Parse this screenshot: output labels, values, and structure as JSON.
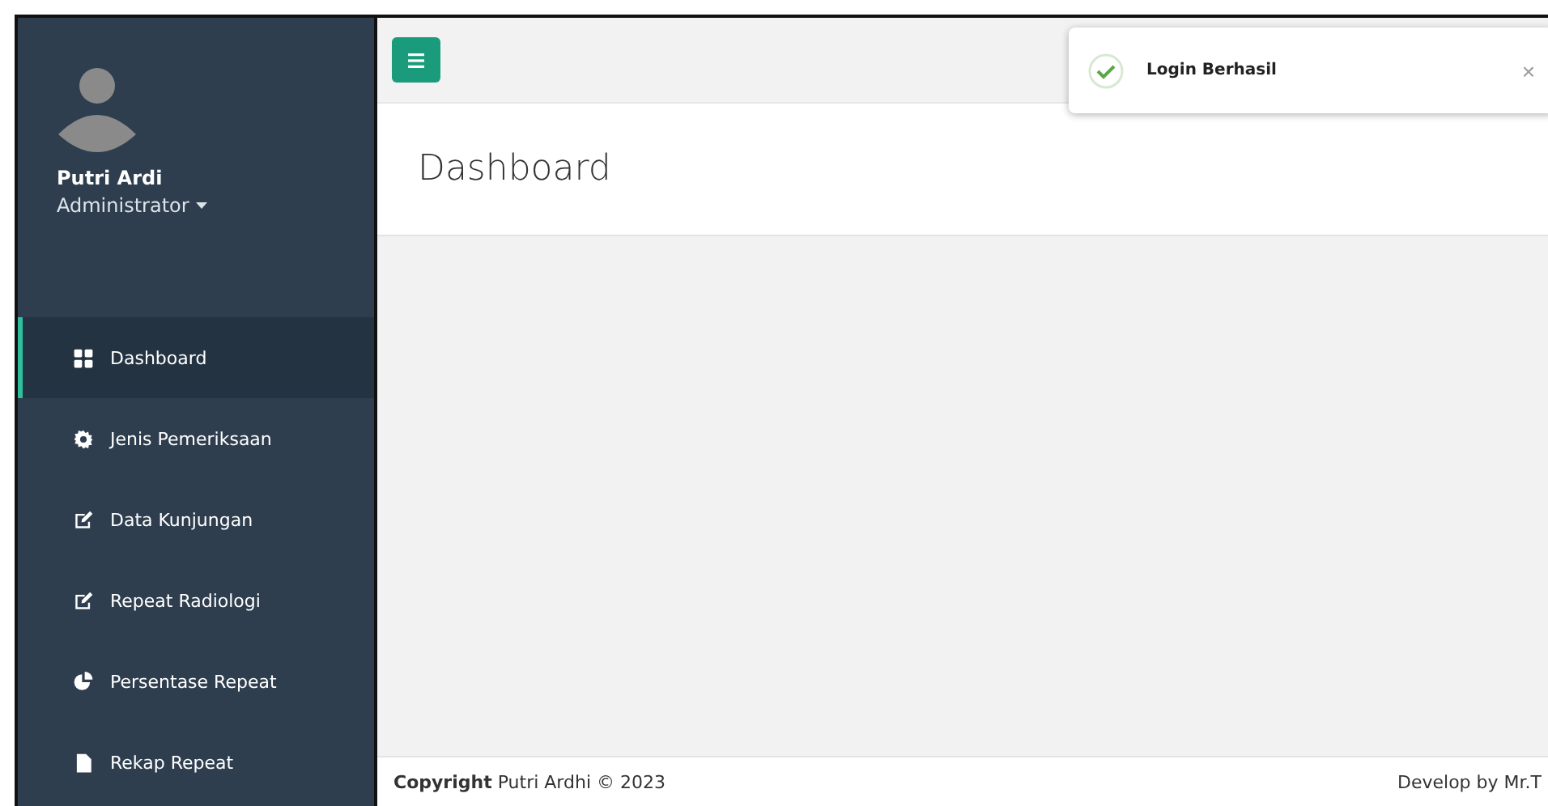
{
  "sidebar": {
    "user": {
      "name": "Putri Ardi",
      "role": "Administrator"
    },
    "items": [
      {
        "label": "Dashboard",
        "selected": true
      },
      {
        "label": "Jenis Pemeriksaan",
        "selected": false
      },
      {
        "label": "Data Kunjungan",
        "selected": false
      },
      {
        "label": "Repeat Radiologi",
        "selected": false
      },
      {
        "label": "Persentase Repeat",
        "selected": false
      },
      {
        "label": "Rekap Repeat",
        "selected": false
      }
    ]
  },
  "page_title": "Dashboard",
  "toast": {
    "message": "Login Berhasil",
    "close": "×"
  },
  "footer": {
    "copyright": "**Copyright** Putri Ardhi © 2023",
    "credit": "Develop by Mr.T"
  }
}
